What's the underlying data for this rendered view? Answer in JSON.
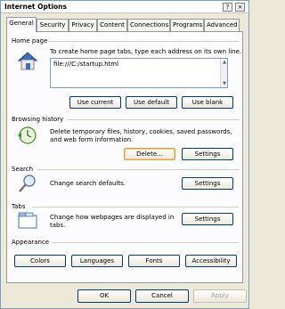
{
  "window": {
    "title": "Internet Options",
    "help_button": "?",
    "close_button": "×"
  },
  "tabs": [
    {
      "label": "General",
      "active": true
    },
    {
      "label": "Security"
    },
    {
      "label": "Privacy"
    },
    {
      "label": "Content"
    },
    {
      "label": "Connections"
    },
    {
      "label": "Programs"
    },
    {
      "label": "Advanced"
    }
  ],
  "home_page": {
    "header": "Home page",
    "description": "To create home page tabs, type each address on its own line.",
    "address_value": "file:///C:/startup.html",
    "use_current": "Use current",
    "use_default": "Use default",
    "use_blank": "Use blank",
    "icon": "house-icon"
  },
  "browsing_history": {
    "header": "Browsing history",
    "description_line1": "Delete temporary files, history, cookies, saved passwords,",
    "description_line2": "and web form information.",
    "delete": "Delete...",
    "settings": "Settings",
    "icon": "history-clock-icon"
  },
  "search": {
    "header": "Search",
    "description": "Change search defaults.",
    "settings": "Settings",
    "icon": "magnifier-icon"
  },
  "tabs_section": {
    "header": "Tabs",
    "description_line1": "Change how webpages are displayed in",
    "description_line2": "tabs.",
    "settings": "Settings",
    "icon": "tabs-icon"
  },
  "appearance": {
    "header": "Appearance",
    "colors": "Colors",
    "languages": "Languages",
    "fonts": "Fonts",
    "accessibility": "Accessibility"
  },
  "footer": {
    "ok": "OK",
    "cancel": "Cancel",
    "apply": "Apply"
  },
  "colors": {
    "border_blue": "#003c74",
    "focus_orange": "#e0a04b",
    "dialog_bg": "#ece9d8",
    "panel_bg": "#fcfcfe"
  }
}
